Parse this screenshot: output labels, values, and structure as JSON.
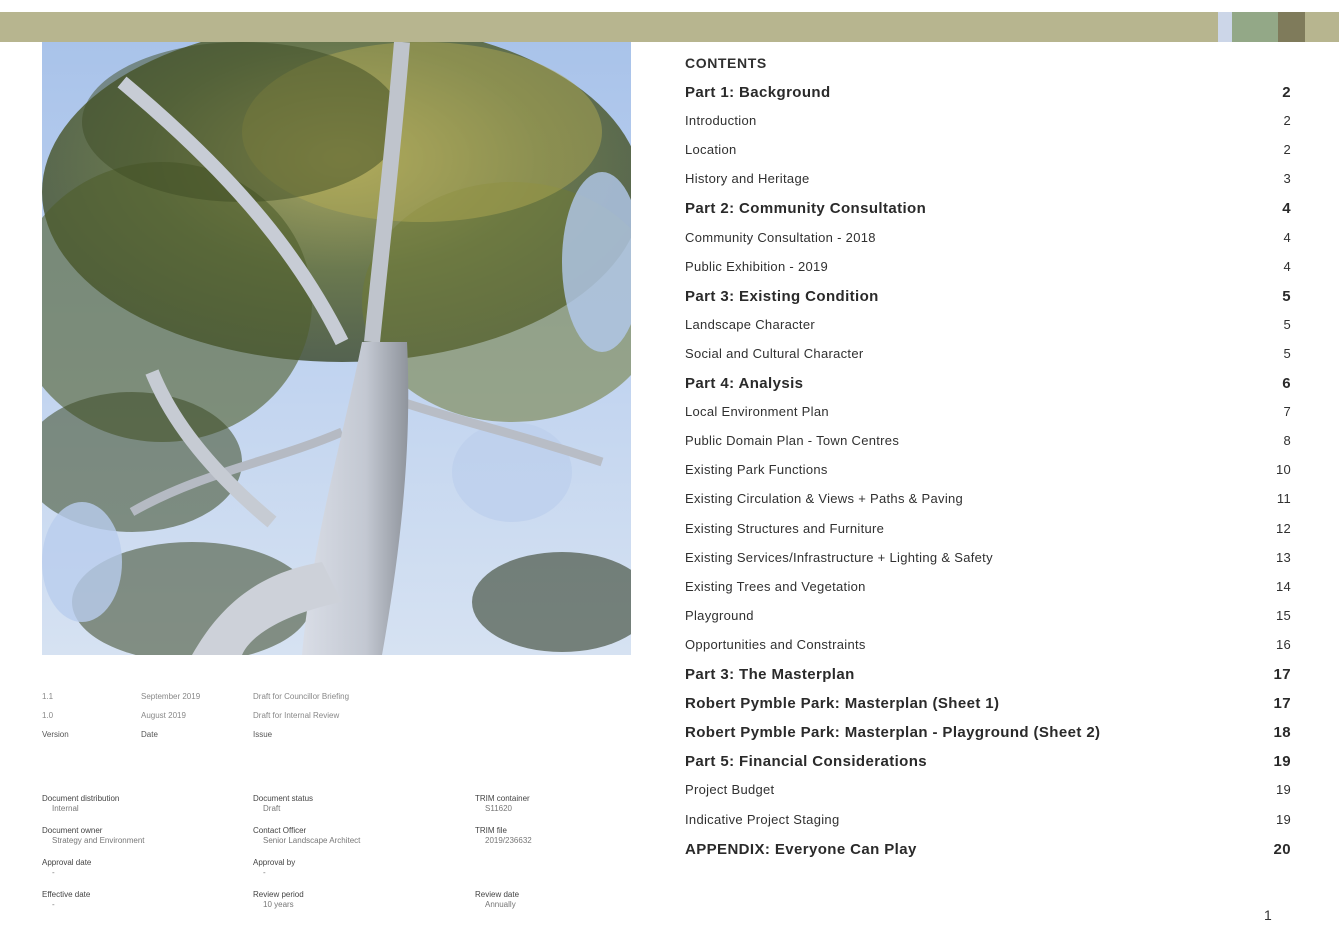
{
  "colors": {
    "topbar": "#b7b58f",
    "segments": [
      "#ccd6e8",
      "#93a887",
      "#7f7b5b"
    ]
  },
  "photo": {
    "icon": "tree-photo"
  },
  "toc": {
    "title": "CONTENTS",
    "entries": [
      {
        "label": "Part 1: Background",
        "page": "2",
        "level": "part"
      },
      {
        "label": "Introduction",
        "page": "2",
        "level": "sub"
      },
      {
        "label": "Location",
        "page": "2",
        "level": "sub"
      },
      {
        "label": "History and Heritage",
        "page": "3",
        "level": "sub"
      },
      {
        "label": "Part 2: Community Consultation",
        "page": "4",
        "level": "part"
      },
      {
        "label": "Community Consultation - 2018",
        "page": "4",
        "level": "sub"
      },
      {
        "label": "Public Exhibition - 2019",
        "page": "4",
        "level": "sub"
      },
      {
        "label": "Part 3: Existing Condition",
        "page": "5",
        "level": "part"
      },
      {
        "label": "Landscape Character",
        "page": "5",
        "level": "sub"
      },
      {
        "label": "Social and Cultural Character",
        "page": "5",
        "level": "sub"
      },
      {
        "label": "Part 4: Analysis",
        "page": "6",
        "level": "part"
      },
      {
        "label": "Local Environment Plan",
        "page": "7",
        "level": "sub"
      },
      {
        "label": "Public Domain Plan - Town Centres",
        "page": "8",
        "level": "sub"
      },
      {
        "label": "Existing Park Functions",
        "page": "10",
        "level": "sub"
      },
      {
        "label": "Existing Circulation & Views + Paths & Paving",
        "page": "11",
        "level": "sub"
      },
      {
        "label": "Existing Structures and Furniture",
        "page": "12",
        "level": "sub"
      },
      {
        "label": "Existing Services/Infrastructure + Lighting & Safety",
        "page": "13",
        "level": "sub"
      },
      {
        "label": "Existing Trees and Vegetation",
        "page": "14",
        "level": "sub"
      },
      {
        "label": "Playground",
        "page": "15",
        "level": "sub"
      },
      {
        "label": "Opportunities and Constraints",
        "page": "16",
        "level": "sub"
      },
      {
        "label": "Part 3: The Masterplan",
        "page": "17",
        "level": "part"
      },
      {
        "label": "Robert Pymble Park: Masterplan (Sheet 1)",
        "page": "17",
        "level": "part"
      },
      {
        "label": "Robert Pymble Park: Masterplan - Playground (Sheet 2)",
        "page": "18",
        "level": "part"
      },
      {
        "label": "Part 5: Financial Considerations",
        "page": "19",
        "level": "part"
      },
      {
        "label": "Project Budget",
        "page": "19",
        "level": "sub"
      },
      {
        "label": "Indicative Project Staging",
        "page": "19",
        "level": "sub"
      },
      {
        "label": "APPENDIX: Everyone Can Play",
        "page": "20",
        "level": "part"
      }
    ]
  },
  "versions": {
    "rows": [
      {
        "version": "1.1",
        "date": "September 2019",
        "issue": "Draft for Councillor Briefing"
      },
      {
        "version": "1.0",
        "date": "August 2019",
        "issue": "Draft for Internal Review"
      }
    ],
    "headers": {
      "version": "Version",
      "date": "Date",
      "issue": "Issue"
    }
  },
  "docinfo": {
    "distribution_label": "Document distribution",
    "distribution": "Internal",
    "status_label": "Document status",
    "status": "Draft",
    "trim_container_label": "TRIM container",
    "trim_container": "S11620",
    "owner_label": "Document owner",
    "owner": "Strategy and Environment",
    "contact_label": "Contact Officer",
    "contact": "Senior Landscape Architect",
    "trim_file_label": "TRIM file",
    "trim_file": "2019/236632",
    "approval_date_label": "Approval date",
    "approval_date": "-",
    "approval_by_label": "Approval by",
    "approval_by": "-",
    "effective_label": "Effective date",
    "effective": "-",
    "review_period_label": "Review period",
    "review_period": "10 years",
    "review_date_label": "Review date",
    "review_date": "Annually"
  },
  "page_number": "1"
}
